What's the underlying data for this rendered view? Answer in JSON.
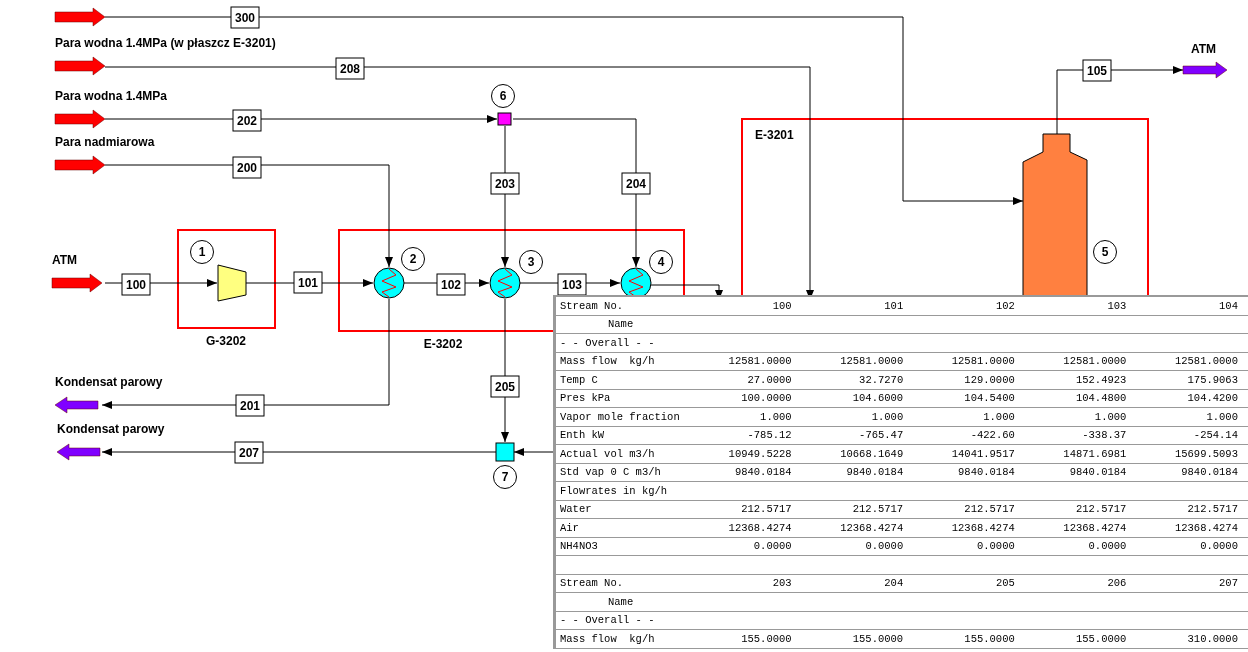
{
  "feeds": [
    {
      "kind": "inlet"
    },
    {
      "label": "Para wodna 1.4MPa (w płaszcz E-3201)",
      "kind": "inlet"
    },
    {
      "label": "Para wodna 1.4MPa",
      "kind": "inlet"
    },
    {
      "label": "Para nadmiarowa",
      "kind": "inlet"
    },
    {
      "label": "ATM",
      "kind": "inlet"
    },
    {
      "label": "Kondensat parowy",
      "kind": "outlet"
    },
    {
      "label": "Kondensat parowy",
      "kind": "outlet"
    },
    {
      "label": "ATM",
      "kind": "outlet"
    }
  ],
  "stream_tags": [
    "300",
    "208",
    "202",
    "200",
    "100",
    "101",
    "102",
    "103",
    "203",
    "204",
    "205",
    "201",
    "207",
    "105"
  ],
  "unit_numbers": [
    "1",
    "2",
    "3",
    "4",
    "5",
    "6",
    "7"
  ],
  "unit_names": [
    "G-3202",
    "E-3202",
    "E-3201"
  ],
  "stream_table": {
    "rows": [
      {
        "kind": "header",
        "label": "Stream No.",
        "values": [
          "100",
          "101",
          "102",
          "103",
          "104"
        ]
      },
      {
        "kind": "indent",
        "label": "Name"
      },
      {
        "kind": "section",
        "label": "- - Overall - -"
      },
      {
        "kind": "value",
        "label": "Mass flow  kg/h",
        "values": [
          "12581.0000",
          "12581.0000",
          "12581.0000",
          "12581.0000",
          "12581.0000"
        ]
      },
      {
        "kind": "value",
        "label": "Temp C",
        "values": [
          "27.0000",
          "32.7270",
          "129.0000",
          "152.4923",
          "175.9063"
        ]
      },
      {
        "kind": "value",
        "label": "Pres kPa",
        "values": [
          "100.0000",
          "104.6000",
          "104.5400",
          "104.4800",
          "104.4200"
        ]
      },
      {
        "kind": "value",
        "label": "Vapor mole fraction",
        "values": [
          "1.000",
          "1.000",
          "1.000",
          "1.000",
          "1.000"
        ]
      },
      {
        "kind": "value",
        "label": "Enth kW",
        "values": [
          "-785.12",
          "-765.47",
          "-422.60",
          "-338.37",
          "-254.14"
        ]
      },
      {
        "kind": "value",
        "label": "Actual vol m3/h",
        "values": [
          "10949.5228",
          "10668.1649",
          "14041.9517",
          "14871.6981",
          "15699.5093"
        ]
      },
      {
        "kind": "value",
        "label": "Std vap 0 C m3/h",
        "values": [
          "9840.0184",
          "9840.0184",
          "9840.0184",
          "9840.0184",
          "9840.0184"
        ]
      },
      {
        "kind": "section",
        "label": "Flowrates in kg/h"
      },
      {
        "kind": "value",
        "label": "Water",
        "values": [
          "212.5717",
          "212.5717",
          "212.5717",
          "212.5717",
          "212.5717"
        ]
      },
      {
        "kind": "value",
        "label": "Air",
        "values": [
          "12368.4274",
          "12368.4274",
          "12368.4274",
          "12368.4274",
          "12368.4274"
        ]
      },
      {
        "kind": "value",
        "label": "NH4NO3",
        "values": [
          "0.0000",
          "0.0000",
          "0.0000",
          "0.0000",
          "0.0000"
        ]
      },
      {
        "kind": "spacer"
      },
      {
        "kind": "header",
        "label": "Stream No.",
        "values": [
          "203",
          "204",
          "205",
          "206",
          "207"
        ]
      },
      {
        "kind": "indent",
        "label": "Name"
      },
      {
        "kind": "section",
        "label": "- - Overall - -"
      },
      {
        "kind": "value",
        "label": "Mass flow  kg/h",
        "values": [
          "155.0000",
          "155.0000",
          "155.0000",
          "155.0000",
          "310.0000"
        ]
      }
    ]
  }
}
